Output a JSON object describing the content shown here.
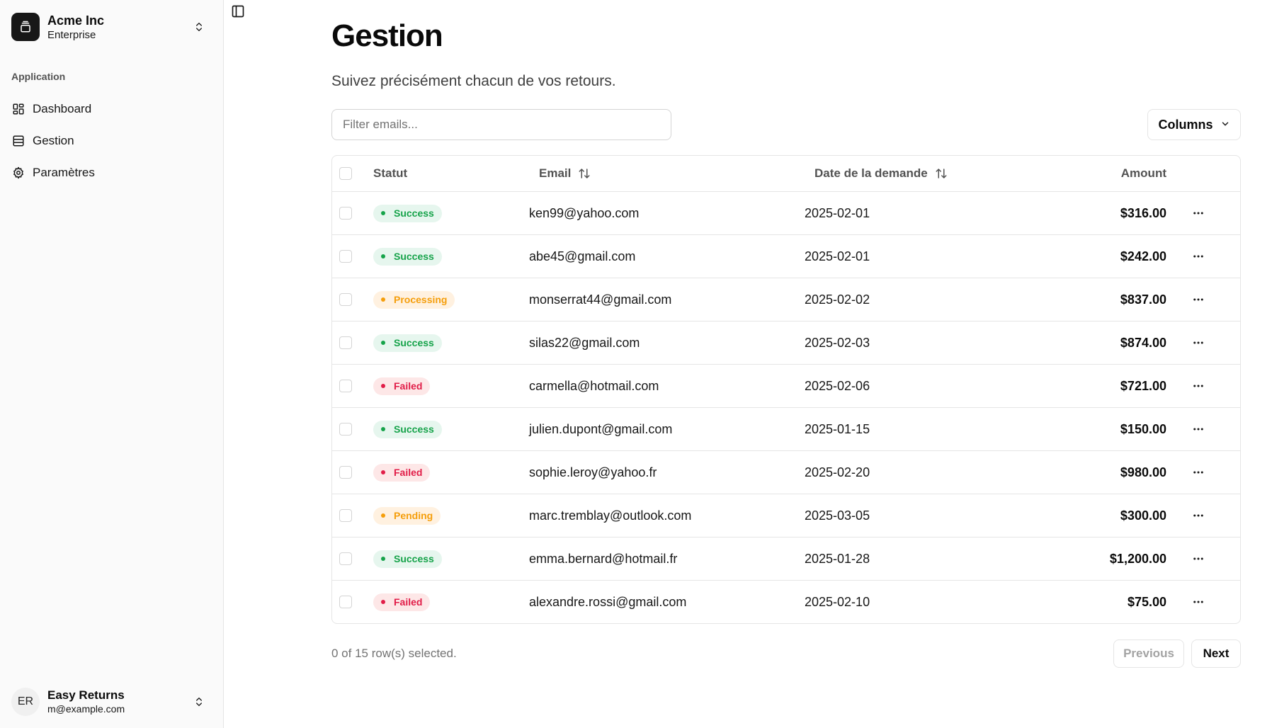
{
  "sidebar": {
    "org": {
      "name": "Acme Inc",
      "plan": "Enterprise",
      "logo_icon": "gallery-icon"
    },
    "group_label": "Application",
    "items": [
      {
        "label": "Dashboard",
        "icon": "layout-dashboard-icon"
      },
      {
        "label": "Gestion",
        "icon": "table-icon"
      },
      {
        "label": "Paramètres",
        "icon": "gear-icon"
      }
    ],
    "user": {
      "initials": "ER",
      "name": "Easy Returns",
      "email": "m@example.com"
    }
  },
  "main": {
    "title": "Gestion",
    "subtitle": "Suivez précisément chacun de vos retours.",
    "filter": {
      "placeholder": "Filter emails...",
      "value": ""
    },
    "columns_button": "Columns",
    "table": {
      "headers": {
        "status": "Statut",
        "email": "Email",
        "date": "Date de la demande",
        "amount": "Amount"
      },
      "rows": [
        {
          "status": "Success",
          "email": "ken99@yahoo.com",
          "date": "2025-02-01",
          "amount": "$316.00"
        },
        {
          "status": "Success",
          "email": "abe45@gmail.com",
          "date": "2025-02-01",
          "amount": "$242.00"
        },
        {
          "status": "Processing",
          "email": "monserrat44@gmail.com",
          "date": "2025-02-02",
          "amount": "$837.00"
        },
        {
          "status": "Success",
          "email": "silas22@gmail.com",
          "date": "2025-02-03",
          "amount": "$874.00"
        },
        {
          "status": "Failed",
          "email": "carmella@hotmail.com",
          "date": "2025-02-06",
          "amount": "$721.00"
        },
        {
          "status": "Success",
          "email": "julien.dupont@gmail.com",
          "date": "2025-01-15",
          "amount": "$150.00"
        },
        {
          "status": "Failed",
          "email": "sophie.leroy@yahoo.fr",
          "date": "2025-02-20",
          "amount": "$980.00"
        },
        {
          "status": "Pending",
          "email": "marc.tremblay@outlook.com",
          "date": "2025-03-05",
          "amount": "$300.00"
        },
        {
          "status": "Success",
          "email": "emma.bernard@hotmail.fr",
          "date": "2025-01-28",
          "amount": "$1,200.00"
        },
        {
          "status": "Failed",
          "email": "alexandre.rossi@gmail.com",
          "date": "2025-02-10",
          "amount": "$75.00"
        }
      ]
    },
    "selection_text": "0 of 15 row(s) selected.",
    "pagination": {
      "previous": "Previous",
      "next": "Next"
    }
  },
  "colors": {
    "success": "#16a34a",
    "processing": "#f59e0b",
    "pending": "#f59e0b",
    "failed": "#e11d48"
  }
}
